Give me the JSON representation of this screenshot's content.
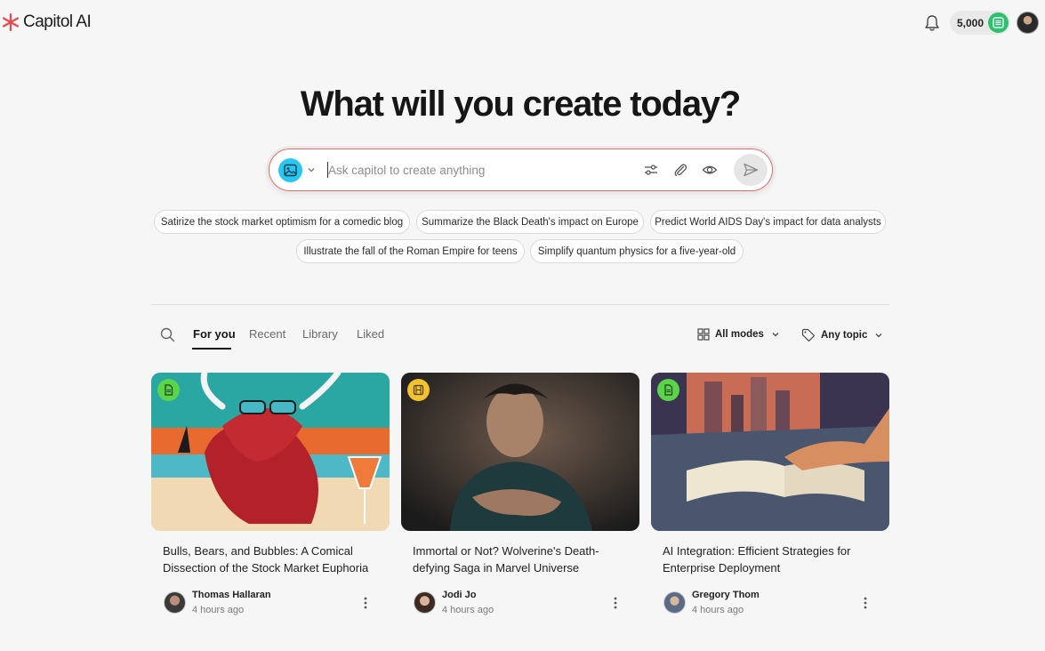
{
  "app": {
    "name": "Capitol AI",
    "brand_color": "#e8484f"
  },
  "header": {
    "credits": "5,000",
    "credits_icon": "coins-icon"
  },
  "hero": {
    "title": "What will you create today?",
    "prompt_placeholder": "Ask capitol to create anything"
  },
  "suggestions": [
    "Satirize the stock market optimism for a comedic blog",
    "Summarize the Black Death's impact on Europe",
    "Predict World AIDS Day's impact for data analysts",
    "Illustrate the fall of the Roman Empire for teens",
    "Simplify quantum physics for a five-year-old"
  ],
  "tabs": [
    "For you",
    "Recent",
    "Library",
    "Liked"
  ],
  "active_tab": "For you",
  "filters": {
    "modes": "All modes",
    "topic": "Any topic"
  },
  "cards": [
    {
      "title": "Bulls, Bears, and Bubbles: A Comical Dissection of the Stock Market Euphoria",
      "author": "Thomas Hallaran",
      "time": "4 hours ago",
      "type": "document",
      "badge_color": "#5ad44a"
    },
    {
      "title": "Immortal or Not? Wolverine's Death-defying Saga in Marvel Universe",
      "author": "Jodi Jo",
      "time": "4 hours ago",
      "type": "video",
      "badge_color": "#f2c230"
    },
    {
      "title": "AI Integration: Efficient Strategies for Enterprise Deployment",
      "author": "Gregory Thom",
      "time": "4 hours ago",
      "type": "document",
      "badge_color": "#5ad44a"
    }
  ]
}
